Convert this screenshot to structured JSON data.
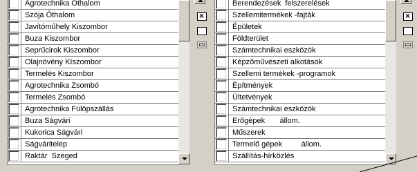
{
  "left_list": {
    "items": [
      "Agrotechnika Öthalom",
      "Szója Öthalom",
      "Javítóműhely Kiszombor",
      "Buza Kiszombor",
      "Seprűcirok Kiszombor",
      "Olajnövény KIszombor",
      "Termelés Kiszombor",
      "Agrotechnika Zsombó",
      "Termelés Zsombó",
      "Agrotechnika Fülöpszállás",
      "Buza Ságvári",
      "Kukorica Ságvári",
      "Ságváritelep",
      "Raktár  Szeged"
    ]
  },
  "right_list": {
    "items": [
      "Berendezések  felszerelések",
      "Szellemitermékek -fajták",
      "Épületek",
      "Földterület",
      "Számtechnikai eszközök",
      "Képzőművészeti alkotások",
      "Szellemi termékek -programok",
      "Építmények",
      "Ültetvények",
      "Számtechnikai eszközök",
      "Erőgépek       állom.",
      "Műszerek",
      "Termelő gépek         állom.",
      "Szállítás-hírközlés"
    ]
  },
  "toolbar": {
    "x_glyph": "×"
  }
}
